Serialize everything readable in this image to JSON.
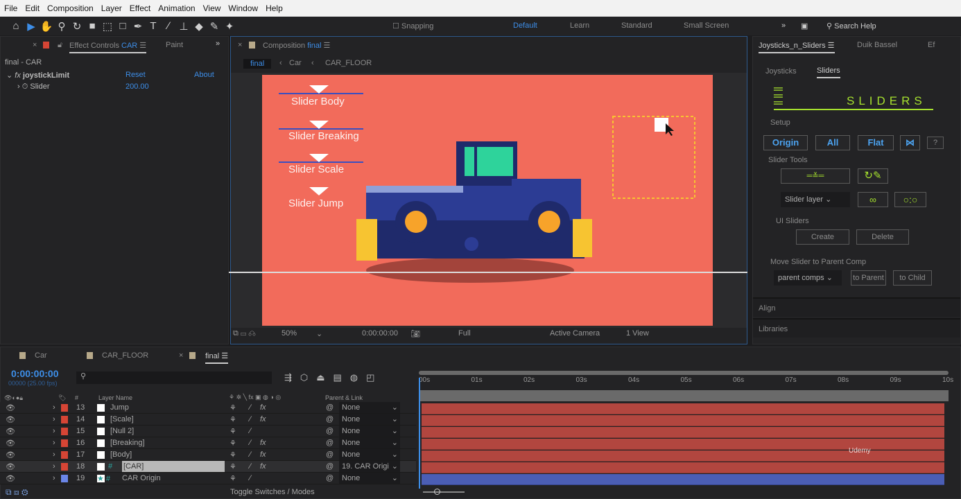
{
  "menu": [
    "File",
    "Edit",
    "Composition",
    "Layer",
    "Effect",
    "Animation",
    "View",
    "Window",
    "Help"
  ],
  "toolbar": {
    "snapping": "Snapping",
    "workspaces": [
      "Default",
      "Learn",
      "Standard",
      "Small Screen"
    ],
    "search_placeholder": "Search Help"
  },
  "effect_controls": {
    "tab": "Effect Controls",
    "tab_layer": "CAR",
    "paint_tab": "Paint",
    "header": "final - CAR",
    "effect_name": "joystickLimit",
    "reset": "Reset",
    "about": "About",
    "prop_name": "Slider",
    "prop_value": "200.00"
  },
  "composition": {
    "tab": "Composition",
    "tab_comp": "final",
    "breadcrumbs": [
      "final",
      "Car",
      "CAR_FLOOR"
    ],
    "canvas_labels": [
      "Slider Body",
      "Slider Breaking",
      "Slider Scale",
      "Slider Jump"
    ],
    "bg_color": "#f26b5b",
    "footer": {
      "zoom": "50%",
      "time": "0:00:00:00",
      "resolution": "Full",
      "camera": "Active Camera",
      "view": "1 View"
    }
  },
  "right_panel": {
    "tabs": [
      "Joysticks_n_Sliders",
      "Duik Bassel",
      "Ef"
    ],
    "subtabs": [
      "Joysticks",
      "Sliders"
    ],
    "logo": "SLIDERS",
    "setup_label": "Setup",
    "setup_buttons": [
      "Origin",
      "All",
      "Flat",
      "?"
    ],
    "slider_tools_label": "Slider Tools",
    "slider_layer_select": "Slider layer",
    "ui_sliders_label": "UI Sliders",
    "create": "Create",
    "delete": "Delete",
    "move_label": "Move Slider to Parent Comp",
    "parent_select": "parent comps",
    "to_parent": "to Parent",
    "to_child": "to Child",
    "align": "Align",
    "libraries": "Libraries",
    "accent": "#a6e22e"
  },
  "timeline": {
    "tabs": [
      "Car",
      "CAR_FLOOR",
      "final"
    ],
    "timecode": "0:00:00:00",
    "fps": "00000 (25.00 fps)",
    "col_layer_name": "Layer Name",
    "col_parent": "Parent & Link",
    "col_hash": "#",
    "ruler": [
      "00s",
      "01s",
      "02s",
      "03s",
      "04s",
      "05s",
      "06s",
      "07s",
      "08s",
      "09s",
      "10s"
    ],
    "layers": [
      {
        "num": "13",
        "name": "Jump",
        "fx": "fx",
        "parent": "None",
        "color": "#d64535"
      },
      {
        "num": "14",
        "name": "[Scale]",
        "fx": "fx",
        "parent": "None",
        "color": "#d64535"
      },
      {
        "num": "15",
        "name": "[Null 2]",
        "fx": "",
        "parent": "None",
        "color": "#d64535"
      },
      {
        "num": "16",
        "name": "[Breaking]",
        "fx": "fx",
        "parent": "None",
        "color": "#d64535"
      },
      {
        "num": "17",
        "name": "[Body]",
        "fx": "fx",
        "parent": "None",
        "color": "#d64535"
      },
      {
        "num": "18",
        "name": "[CAR]",
        "fx": "fx",
        "parent": "19. CAR Origi",
        "color": "#d64535"
      },
      {
        "num": "19",
        "name": "CAR Origin",
        "fx": "",
        "parent": "None",
        "color": "#6b86e8"
      }
    ],
    "toggle": "Toggle Switches / Modes",
    "watermark": "Udemy"
  }
}
